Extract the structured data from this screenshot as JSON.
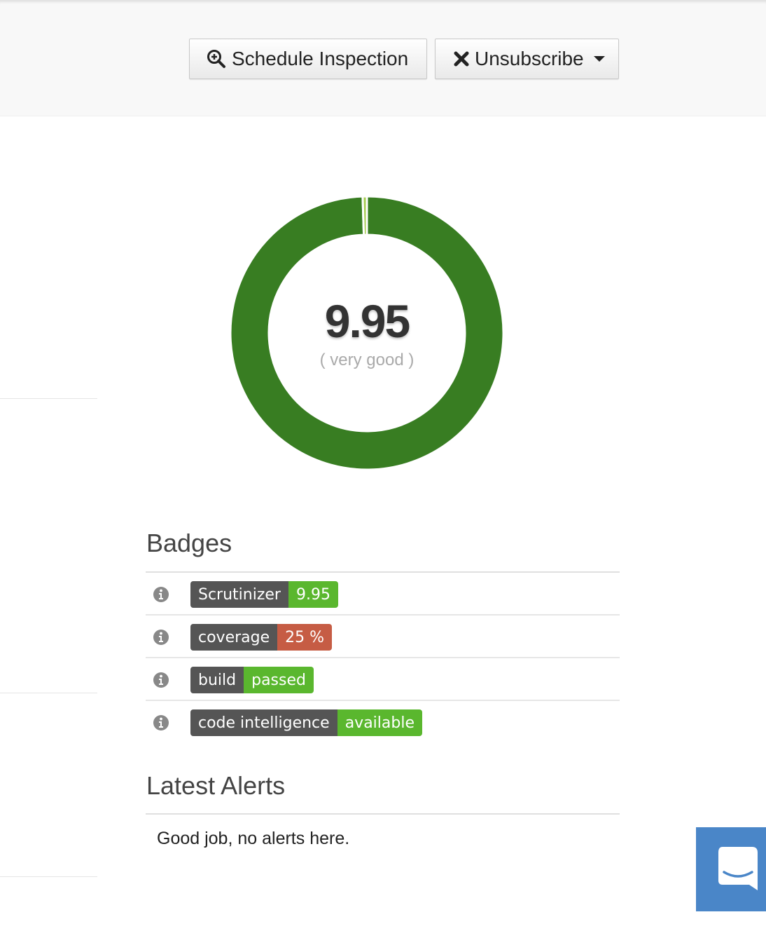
{
  "toolbar": {
    "schedule_label": "Schedule Inspection",
    "unsubscribe_label": "Unsubscribe"
  },
  "quality": {
    "score": "9.95",
    "score_value": 9.95,
    "max": 10,
    "rating": "( very good )",
    "colors": {
      "main": "#387d22",
      "remainder": "#a5cc4f"
    }
  },
  "badges": {
    "title": "Badges",
    "items": [
      {
        "label": "Scrutinizer",
        "value": "9.95",
        "color": "#5ab72e"
      },
      {
        "label": "coverage",
        "value": "25 %",
        "color": "#c65c44"
      },
      {
        "label": "build",
        "value": "passed",
        "color": "#5ab72e"
      },
      {
        "label": "code intelligence",
        "value": "available",
        "color": "#5ab72e"
      }
    ]
  },
  "alerts": {
    "title": "Latest Alerts",
    "empty_message": "Good job, no alerts here."
  }
}
